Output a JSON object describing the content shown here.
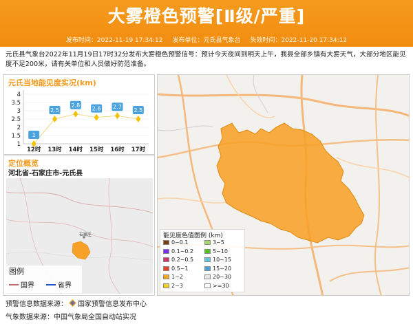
{
  "header": {
    "title": "大雾橙色预警[Ⅱ级/严重]",
    "publish_time_label": "发布时间：2022-11-19 17:34:12",
    "publish_unit_label": "发布单位：元氏县气象台",
    "expire_time_label": "失效时间：2022-11-20 17:34:12"
  },
  "description": "元氏县气象台2022年11月19日17时32分发布大雾橙色预警信号：预计今天夜间到明天上午，我县全部乡镇有大雾天气，大部分地区能见度不足200米，请有关单位和人员做好防范准备。",
  "visibility_panel": {
    "title": "元氏当地能见度实况(km)"
  },
  "chart_data": {
    "type": "line",
    "title": "元氏当地能见度实况(km)",
    "categories": [
      "12时",
      "13时",
      "14时",
      "15时",
      "16时",
      "17时"
    ],
    "values": [
      1,
      2.5,
      2.8,
      2.6,
      2.7,
      2.5
    ],
    "ylim": [
      1,
      3
    ],
    "yticks": [
      "1",
      "1.5",
      "2",
      "2.5",
      "3",
      "3.5",
      "4"
    ]
  },
  "location_panel": {
    "title": "定位概览",
    "path": "河北省-石家庄市-元氏县",
    "city_label": "石家庄",
    "legend_title": "图例",
    "legend_items": [
      {
        "label": "国界",
        "color": "#c96a6a"
      },
      {
        "label": "省界",
        "color": "#1a52c9"
      }
    ]
  },
  "vis_legend": {
    "title": "能见度色值图例 (km)",
    "items": [
      {
        "label": "0~0.1",
        "color": "#7a3b12"
      },
      {
        "label": "3~5",
        "color": "#a6d96a"
      },
      {
        "label": "0.1~0.2",
        "color": "#7b2ff0"
      },
      {
        "label": "5~10",
        "color": "#52c41a"
      },
      {
        "label": "0.2~0.5",
        "color": "#d6336c"
      },
      {
        "label": "10~15",
        "color": "#5cc8e6"
      },
      {
        "label": "0.5~1",
        "color": "#e8442a"
      },
      {
        "label": "15~20",
        "color": "#4aa3df"
      },
      {
        "label": "1~2",
        "color": "#f5a623"
      },
      {
        "label": "20~30",
        "color": "#e6e6e6"
      },
      {
        "label": "2~3",
        "color": "#f2d024"
      },
      {
        "label": ">=30",
        "color": "#ffffff"
      }
    ]
  },
  "footer": {
    "warning_source": "预警信息数据来源：",
    "warning_source_name": "国家预警信息发布中心",
    "weather_source": "气象数据来源：中国气象局全国自动站实况"
  },
  "colors": {
    "accent": "#f59a1e",
    "warning_fill": "#f7a128"
  }
}
